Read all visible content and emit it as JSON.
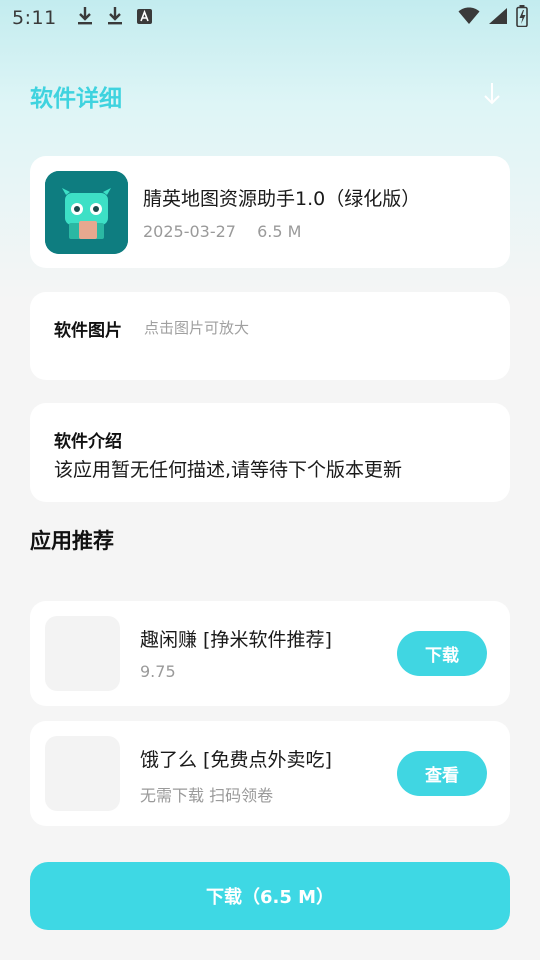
{
  "status_bar": {
    "time": "5:11",
    "icons": [
      "download-icon",
      "download-icon",
      "a-icon",
      "wifi-icon",
      "signal-icon",
      "battery-icon"
    ]
  },
  "header": {
    "title": "软件详细",
    "action_icon": "download-arrow-icon"
  },
  "app": {
    "name": "腈英地图资源助手1.0（绿化版）",
    "date": "2025-03-27",
    "size": "6.5 M"
  },
  "images_section": {
    "label": "软件图片",
    "hint": "点击图片可放大"
  },
  "intro_section": {
    "label": "软件介绍",
    "description": "该应用暂无任何描述,请等待下个版本更新"
  },
  "recommendations": {
    "title": "应用推荐",
    "items": [
      {
        "name": "趣闲赚 [挣米软件推荐]",
        "subtitle": "9.75",
        "button": "下载"
      },
      {
        "name": "饿了么 [免费点外卖吃]",
        "subtitle": "无需下载 扫码领卷",
        "button": "查看"
      }
    ]
  },
  "download_button": {
    "label": "下载（6.5 M）"
  },
  "colors": {
    "accent": "#3ed8e4",
    "title": "#3fd3df",
    "app_icon_bg": "#0e7d80"
  }
}
